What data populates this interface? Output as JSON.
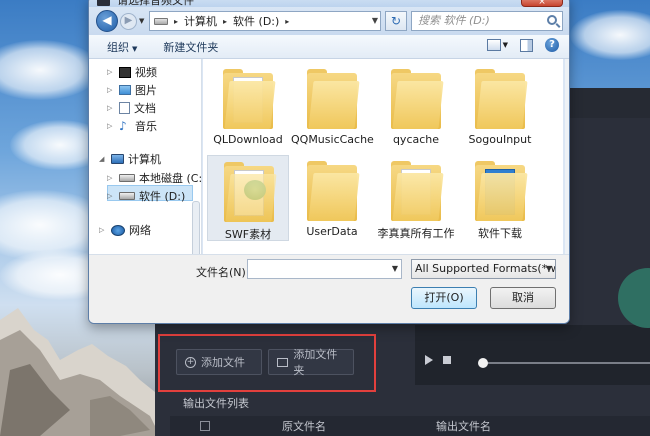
{
  "dialog": {
    "title": "请选择音频文件",
    "close_label": "×",
    "breadcrumb": [
      "计算机",
      "软件 (D:)"
    ],
    "search_placeholder": "搜索 软件 (D:)",
    "toolbar": {
      "organize": "组织",
      "new_folder": "新建文件夹"
    },
    "nav": {
      "libraries": [
        "视频",
        "图片",
        "文档",
        "音乐"
      ],
      "computer": "计算机",
      "drives": [
        "本地磁盘 (C:)",
        "软件 (D:)"
      ],
      "network": "网络"
    },
    "files": [
      "QLDownload",
      "QQMusicCache",
      "qycache",
      "SogouInput",
      "SWF素材",
      "UserData",
      "李真真所有工作",
      "软件下载"
    ],
    "filename_label": "文件名(N):",
    "filename_value": "",
    "filetype": "All Supported Formats(*.wav",
    "open_button": "打开(O)",
    "cancel_button": "取消"
  },
  "app": {
    "add_file": "添加文件",
    "add_folder": "添加文件夹",
    "output_list": "输出文件列表",
    "col_original": "原文件名",
    "col_output": "输出文件名"
  }
}
